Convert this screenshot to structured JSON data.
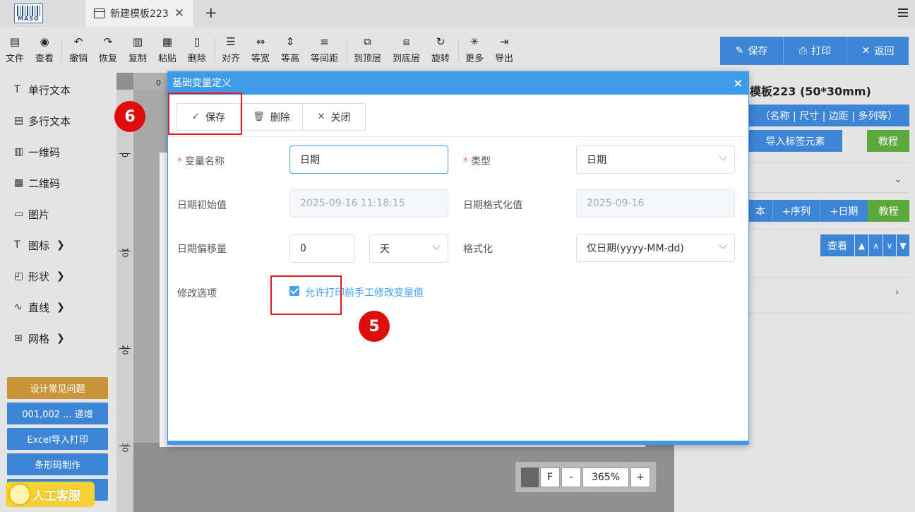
{
  "app": {
    "logo_text": "MASO"
  },
  "tabs": [
    {
      "label": "新建模板223"
    }
  ],
  "toolbar": {
    "items": [
      {
        "label": "文件",
        "icon": "file-icon"
      },
      {
        "label": "查看",
        "icon": "eye-icon"
      },
      {
        "label": "撤销",
        "icon": "undo-icon"
      },
      {
        "label": "恢复",
        "icon": "redo-icon"
      },
      {
        "label": "复制",
        "icon": "copy-icon"
      },
      {
        "label": "粘贴",
        "icon": "paste-icon"
      },
      {
        "label": "删除",
        "icon": "trash-icon"
      },
      {
        "label": "对齐",
        "icon": "align-icon"
      },
      {
        "label": "等宽",
        "icon": "equal-width-icon"
      },
      {
        "label": "等高",
        "icon": "equal-height-icon"
      },
      {
        "label": "等间距",
        "icon": "equal-spacing-icon"
      },
      {
        "label": "到顶层",
        "icon": "bring-front-icon"
      },
      {
        "label": "到底层",
        "icon": "send-back-icon"
      },
      {
        "label": "旋转",
        "icon": "rotate-icon"
      },
      {
        "label": "更多",
        "icon": "more-icon"
      },
      {
        "label": "导出",
        "icon": "export-icon"
      }
    ],
    "right": {
      "save": "保存",
      "print": "打印",
      "back": "返回"
    }
  },
  "sidebar": {
    "items": [
      {
        "label": "单行文本"
      },
      {
        "label": "多行文本"
      },
      {
        "label": "一维码"
      },
      {
        "label": "二维码"
      },
      {
        "label": "图片"
      },
      {
        "label": "图标"
      },
      {
        "label": "形状"
      },
      {
        "label": "直线"
      },
      {
        "label": "网格"
      }
    ],
    "buttons": [
      {
        "label": "设计常见问题",
        "color": "#c9953a"
      },
      {
        "label": "001,002 ... 递增",
        "color": "#3d85d6"
      },
      {
        "label": "Excel导入打印",
        "color": "#3d85d6"
      },
      {
        "label": "条形码制作",
        "color": "#3d85d6"
      }
    ],
    "service": "人工客服"
  },
  "ruler": {
    "left_labels": [
      "0",
      "10",
      "20",
      "30"
    ],
    "top_label": "0"
  },
  "zoom": {
    "fit": "F",
    "minus": "-",
    "value": "365%",
    "plus": "+"
  },
  "right_panel": {
    "title": "模板223 (50*30mm)",
    "settings_button": "（名称 | 尺寸 | 边距 | 多列等）",
    "import_button": "导入标签元素",
    "tutorial": "教程",
    "var_buttons": [
      "本",
      "+序列",
      "+日期"
    ],
    "var_tutorial": "教程",
    "view": "查看",
    "arrows": [
      "▲",
      "∧",
      "∨",
      "▼"
    ]
  },
  "modal": {
    "title": "基础变量定义",
    "close": "×",
    "buttons": {
      "save": "保存",
      "delete": "删除",
      "close": "关闭"
    },
    "fields": {
      "var_name_label": "变量名称",
      "var_name_value": "日期",
      "type_label": "类型",
      "type_value": "日期",
      "date_init_label": "日期初始值",
      "date_init_value": "2025-09-16 11:18:15",
      "date_fmt_label": "日期格式化值",
      "date_fmt_value": "2025-09-16",
      "offset_label": "日期偏移量",
      "offset_value": "0",
      "offset_unit": "天",
      "format_label": "格式化",
      "format_value": "仅日期(yyyy-MM-dd)",
      "modify_label": "修改选项",
      "modify_checkbox": "允许打印前手工修改变量值"
    }
  },
  "annotations": {
    "badge_6": "6",
    "badge_5": "5"
  }
}
